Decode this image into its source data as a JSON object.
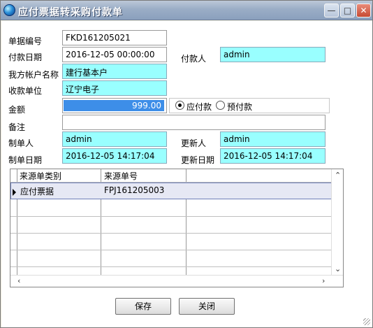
{
  "window": {
    "title": "应付票据转采购付款单",
    "min_glyph": "—",
    "max_glyph": "□",
    "close_glyph": "✕"
  },
  "form": {
    "doc_no_label": "单据编号",
    "doc_no": "FKD161205021",
    "pay_date_label": "付款日期",
    "pay_date": "2016-12-05 00:00:00",
    "payer_label": "付款人",
    "payer": "admin",
    "our_account_label": "我方帐户名称",
    "our_account": "建行基本户",
    "payee_label": "收款单位",
    "payee": "辽宁电子",
    "amount_label": "金额",
    "amount": "999.00",
    "payment_type_options": [
      "应付款",
      "预付款"
    ],
    "payment_type_selected": "应付款",
    "remark_label": "备注",
    "remark": "",
    "creator_label": "制单人",
    "creator": "admin",
    "updater_label": "更新人",
    "updater": "admin",
    "create_date_label": "制单日期",
    "create_date": "2016-12-05 14:17:04",
    "update_date_label": "更新日期",
    "update_date": "2016-12-05 14:17:04"
  },
  "grid": {
    "columns": [
      "来源单类别",
      "来源单号"
    ],
    "rows": [
      [
        "应付票据",
        "FPJ161205003"
      ]
    ]
  },
  "buttons": {
    "save": "保存",
    "close": "关闭"
  },
  "colors": {
    "readonly_field": "#99ffff",
    "amount_highlight": "#3d8ee8"
  }
}
